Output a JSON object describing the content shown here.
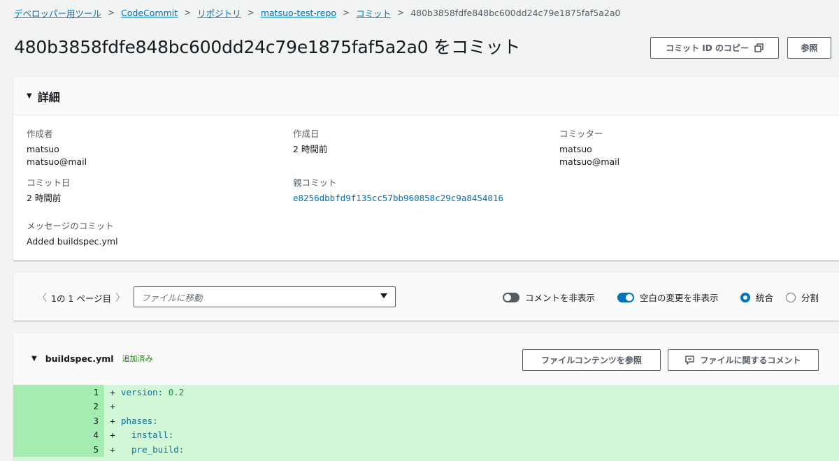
{
  "breadcrumb": {
    "items": [
      "デベロッパー用ツール",
      "CodeCommit",
      "リポジトリ",
      "matsuo-test-repo",
      "コミット"
    ],
    "current": "480b3858fdfe848bc600dd24c79e1875faf5a2a0"
  },
  "page_title": "480b3858fdfe848bc600dd24c79e1875faf5a2a0 をコミット",
  "header_buttons": {
    "copy_commit_id": "コミット ID のコピー",
    "browse": "参照"
  },
  "details": {
    "title": "詳細",
    "author_label": "作成者",
    "author_name": "matsuo",
    "author_email": "matsuo@mail",
    "created_label": "作成日",
    "created_value": "2 時間前",
    "committer_label": "コミッター",
    "committer_name": "matsuo",
    "committer_email": "matsuo@mail",
    "commit_date_label": "コミット日",
    "commit_date_value": "2 時間前",
    "parent_label": "親コミット",
    "parent_value": "e8256dbbfd9f135cc57bb960858c29c9a8454016",
    "message_label": "メッセージのコミット",
    "message_value": "Added buildspec.yml"
  },
  "toolbar": {
    "pager_text": "1の 1 ページ目",
    "goto_placeholder": "ファイルに移動",
    "hide_comments_label": "コメントを非表示",
    "hide_comments_on": false,
    "hide_whitespace_label": "空白の変更を非表示",
    "hide_whitespace_on": true,
    "view_unified_label": "統合",
    "view_split_label": "分割",
    "selected_view": "unified"
  },
  "file": {
    "name": "buildspec.yml",
    "status": "追加済み",
    "view_content_button": "ファイルコンテンツを参照",
    "comment_button": "ファイルに関するコメント",
    "lines": [
      {
        "n": "1",
        "prefix": "+",
        "code": "version: ",
        "num": "0.2"
      },
      {
        "n": "2",
        "prefix": "+",
        "code": "",
        "num": ""
      },
      {
        "n": "3",
        "prefix": "+",
        "code": "phases:",
        "num": ""
      },
      {
        "n": "4",
        "prefix": "+",
        "code": "  install:",
        "num": ""
      },
      {
        "n": "5",
        "prefix": "+",
        "code": "  pre_build:",
        "num": ""
      }
    ]
  },
  "colors": {
    "link": "#0073bb",
    "toggle_on": "#0073bb",
    "toggle_off": "#545b64",
    "added_bg": "#d3f8d8",
    "added_gutter": "#a5ecb0",
    "added_badge": "#1d8102"
  }
}
